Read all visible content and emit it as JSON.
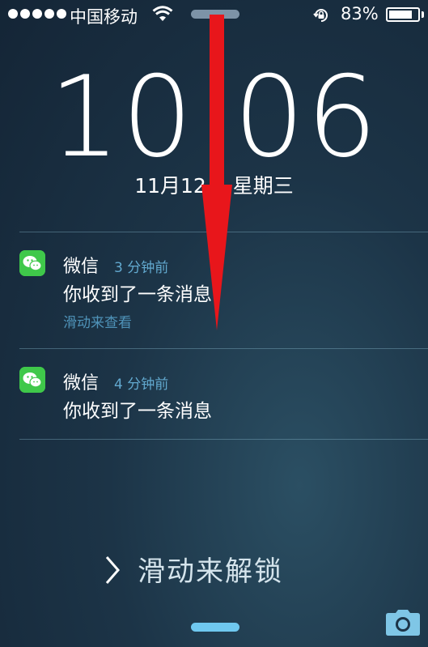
{
  "status_bar": {
    "carrier": "中国移动",
    "battery_percent": "83%",
    "battery_level": 0.83,
    "icons": [
      "signal-dots",
      "wifi-icon",
      "orientation-lock-icon",
      "battery-icon"
    ]
  },
  "clock": {
    "time": "10:06",
    "date": "11月12日 星期三"
  },
  "notifications": [
    {
      "app": "微信",
      "time_ago": "3 分钟前",
      "message": "你收到了一条消息",
      "hint": "滑动来查看"
    },
    {
      "app": "微信",
      "time_ago": "4 分钟前",
      "message": "你收到了一条消息"
    }
  ],
  "unlock": {
    "label": "滑动来解锁"
  },
  "colors": {
    "accent_blue": "#62a9cf",
    "wechat_green": "#3fc84a",
    "arrow_red": "#e8161b"
  }
}
